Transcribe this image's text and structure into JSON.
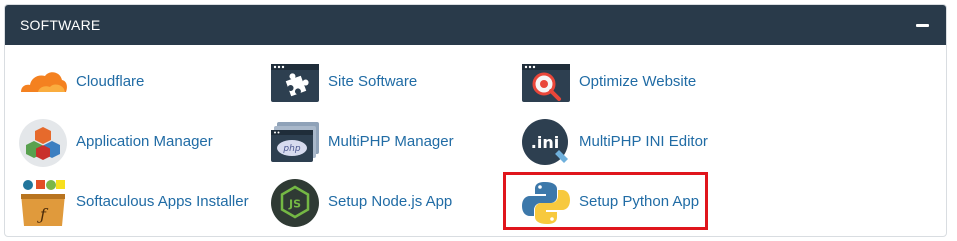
{
  "panel": {
    "title": "SOFTWARE",
    "collapse_icon": "minus-icon"
  },
  "items": [
    {
      "label": "Cloudflare",
      "icon": "cloudflare-icon"
    },
    {
      "label": "Site Software",
      "icon": "puzzle-piece-icon"
    },
    {
      "label": "Optimize Website",
      "icon": "magnifier-gear-icon"
    },
    {
      "label": "Application Manager",
      "icon": "app-cubes-icon"
    },
    {
      "label": "MultiPHP Manager",
      "icon": "php-stack-icon",
      "icon_text": "php"
    },
    {
      "label": "MultiPHP INI Editor",
      "icon": "ini-file-icon",
      "icon_text": ".ini"
    },
    {
      "label": "Softaculous Apps Installer",
      "icon": "softaculous-icon"
    },
    {
      "label": "Setup Node.js App",
      "icon": "nodejs-icon",
      "icon_text": "JS"
    },
    {
      "label": "Setup Python App",
      "icon": "python-icon"
    }
  ],
  "highlighted_item": "Setup Python App",
  "colors": {
    "header_bg": "#293a4a",
    "link": "#216ca5",
    "highlight_border": "#e0151c"
  }
}
